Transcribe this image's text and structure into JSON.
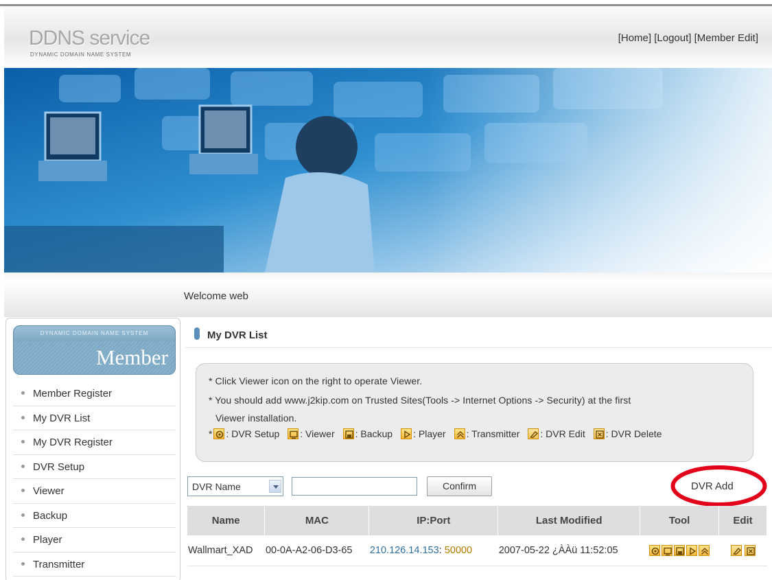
{
  "header": {
    "logo_title": "DDNS service",
    "logo_subtitle": "DYNAMIC DOMAIN NAME SYSTEM",
    "links": [
      "[Home]",
      "[Logout]",
      "[Member Edit]"
    ]
  },
  "welcome": "Welcome web",
  "sidebar": {
    "box_caption": "DYNAMIC DOMAIN NAME SYSTEM",
    "box_title": "Member",
    "items": [
      {
        "label": "Member Register"
      },
      {
        "label": "My DVR List"
      },
      {
        "label": "My DVR Register"
      },
      {
        "label": "DVR Setup"
      },
      {
        "label": "Viewer"
      },
      {
        "label": "Backup"
      },
      {
        "label": "Player"
      },
      {
        "label": "Transmitter"
      }
    ]
  },
  "main": {
    "section_title": "My DVR List",
    "info": {
      "line1": "* Click Viewer icon on the right to operate Viewer.",
      "line2": "* You should add www.j2kip.com on Trusted Sites(Tools -> Internet Options -> Security) at the first",
      "line3": "Viewer installation.",
      "legend_prefix": "*",
      "legend": [
        {
          "icon": "dvr-setup-icon",
          "label": ": DVR Setup"
        },
        {
          "icon": "viewer-icon",
          "label": ": Viewer"
        },
        {
          "icon": "backup-icon",
          "label": ": Backup"
        },
        {
          "icon": "player-icon",
          "label": ": Player"
        },
        {
          "icon": "transmitter-icon",
          "label": ": Transmitter"
        },
        {
          "icon": "dvr-edit-icon",
          "label": ": DVR Edit"
        },
        {
          "icon": "dvr-delete-icon",
          "label": ": DVR Delete"
        }
      ]
    },
    "search": {
      "select_value": "DVR Name",
      "input_value": "",
      "confirm_label": "Confirm",
      "dvr_add_label": "DVR Add"
    },
    "table": {
      "headers": [
        "Name",
        "MAC",
        "IP:Port",
        "Last Modified",
        "Tool",
        "Edit"
      ],
      "rows": [
        {
          "name": "Wallmart_XAD",
          "mac": "00-0A-A2-06-D3-65",
          "ip": "210.126.14.153",
          "port_sep": ":",
          "port": "50000",
          "modified": "2007-05-22 ¿ÀÀü 11:52:05"
        }
      ]
    }
  },
  "colors": {
    "accent": "#5b8fb9",
    "icon_fill": "#f3b63b",
    "highlight_ellipse": "#e3001b"
  }
}
